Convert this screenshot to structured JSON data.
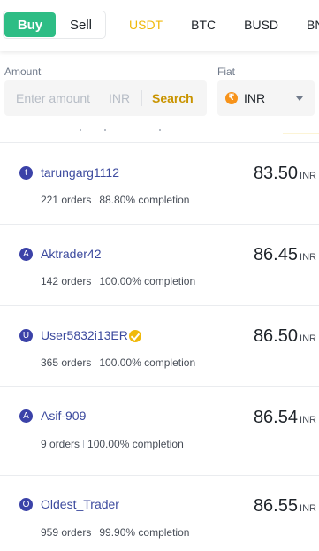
{
  "trade_toggle": {
    "buy_label": "Buy",
    "sell_label": "Sell"
  },
  "asset_tabs": [
    {
      "label": "USDT",
      "active": true
    },
    {
      "label": "BTC",
      "active": false
    },
    {
      "label": "BUSD",
      "active": false
    },
    {
      "label": "BNB",
      "active": false
    }
  ],
  "filters": {
    "amount_label": "Amount",
    "amount_placeholder": "Enter amount",
    "amount_currency": "INR",
    "search_label": "Search",
    "fiat_label": "Fiat",
    "fiat_value": "INR",
    "fiat_icon": "rupee-coin-icon"
  },
  "colors": {
    "buy": "#2ebd85",
    "accent": "#f0b90b",
    "link": "#3c4a9e",
    "avatar": "#3b42a8"
  },
  "offers": [
    {
      "avatar_letter": "t",
      "username": "tarungarg1112",
      "verified": false,
      "orders": "221 orders",
      "completion": "88.80% completion",
      "price": "83.50",
      "currency": "INR"
    },
    {
      "avatar_letter": "A",
      "username": "Aktrader42",
      "verified": false,
      "orders": "142 orders",
      "completion": "100.00% completion",
      "price": "86.45",
      "currency": "INR"
    },
    {
      "avatar_letter": "U",
      "username": "User5832i13ER",
      "verified": true,
      "orders": "365 orders",
      "completion": "100.00% completion",
      "price": "86.50",
      "currency": "INR"
    },
    {
      "avatar_letter": "A",
      "username": "Asif-909",
      "verified": false,
      "orders": "9 orders",
      "completion": "100.00% completion",
      "price": "86.54",
      "currency": "INR"
    },
    {
      "avatar_letter": "O",
      "username": "Oldest_Trader",
      "verified": false,
      "orders": "959 orders",
      "completion": "99.90% completion",
      "price": "86.55",
      "currency": "INR"
    }
  ]
}
